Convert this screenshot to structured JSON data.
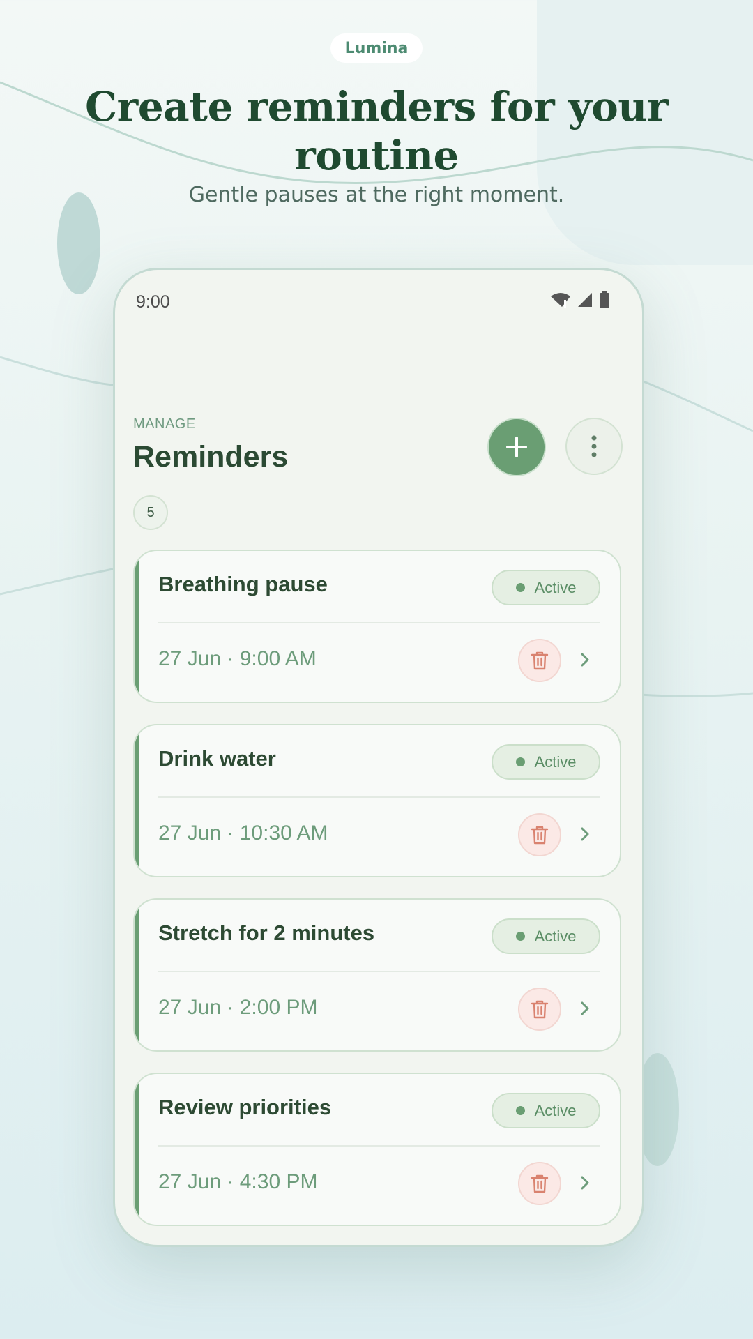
{
  "brand": "Lumina",
  "headline": "Create reminders for your routine",
  "subtitle": "Gentle pauses at the right moment.",
  "status_bar": {
    "time": "9:00",
    "icons": [
      "wifi-icon",
      "signal-icon",
      "battery-icon"
    ]
  },
  "screen": {
    "eyebrow": "MANAGE",
    "title": "Reminders",
    "count": "5",
    "add_icon": "plus-icon",
    "more_icon": "more-vertical-icon"
  },
  "reminders": [
    {
      "title": "Breathing pause",
      "status": "Active",
      "time": "27 Jun · 9:00 AM"
    },
    {
      "title": "Drink water",
      "status": "Active",
      "time": "27 Jun · 10:30 AM"
    },
    {
      "title": "Stretch for 2 minutes",
      "status": "Active",
      "time": "27 Jun · 2:00 PM"
    },
    {
      "title": "Review priorities",
      "status": "Active",
      "time": "27 Jun · 4:30 PM"
    }
  ],
  "colors": {
    "accent": "#6a9e73",
    "headline": "#1f4a30",
    "brand": "#4d8b72",
    "delete": "#d9826f"
  }
}
